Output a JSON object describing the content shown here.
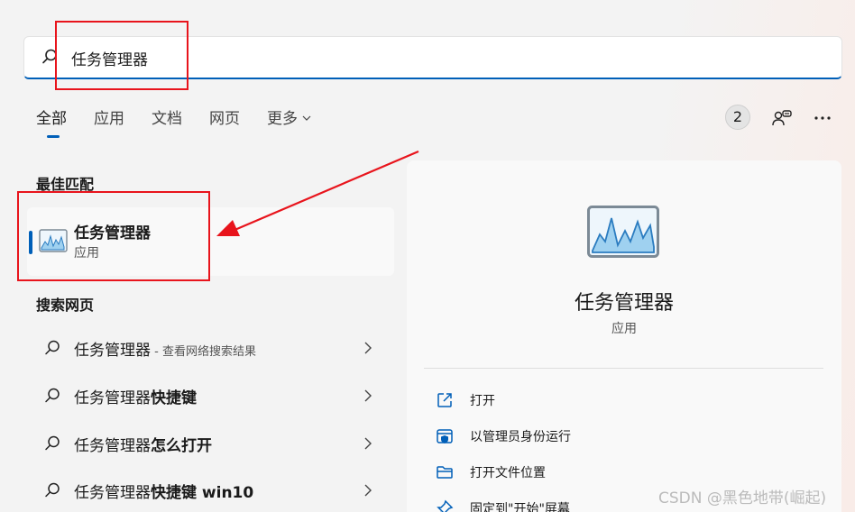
{
  "search": {
    "value": "任务管理器"
  },
  "tabs": [
    {
      "label": "全部"
    },
    {
      "label": "应用"
    },
    {
      "label": "文档"
    },
    {
      "label": "网页"
    },
    {
      "label": "更多"
    }
  ],
  "header": {
    "badge_count": "2"
  },
  "best_match": {
    "title": "最佳匹配",
    "name": "任务管理器",
    "kind": "应用"
  },
  "web_search": {
    "title": "搜索网页",
    "items": [
      {
        "prefix": "任务管理器",
        "bold": "",
        "sub": " - 查看网络搜索结果"
      },
      {
        "prefix": "任务管理器",
        "bold": "快捷键",
        "sub": ""
      },
      {
        "prefix": "任务管理器",
        "bold": "怎么打开",
        "sub": ""
      },
      {
        "prefix": "任务管理器",
        "bold": "快捷键 win10",
        "sub": ""
      }
    ]
  },
  "detail": {
    "name": "任务管理器",
    "kind": "应用",
    "actions": [
      {
        "label": "打开",
        "icon": "open-external-icon"
      },
      {
        "label": "以管理员身份运行",
        "icon": "shield-icon"
      },
      {
        "label": "打开文件位置",
        "icon": "folder-icon"
      },
      {
        "label": "固定到\"开始\"屏幕",
        "icon": "pin-icon"
      }
    ]
  },
  "watermark": "CSDN @黑色地带(崛起)",
  "colors": {
    "accent": "#005fb8",
    "highlight": "#e8141c"
  }
}
